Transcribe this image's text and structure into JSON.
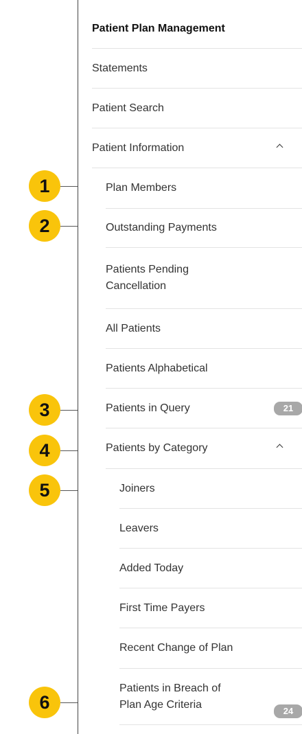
{
  "nav": {
    "title": "Patient Plan Management",
    "statements": "Statements",
    "patient_search": "Patient Search",
    "patient_information": "Patient Information",
    "plan_members": "Plan Members",
    "outstanding_payments": "Outstanding Payments",
    "patients_pending_cancellation": [
      "Patients Pending",
      "Cancellation"
    ],
    "all_patients": "All Patients",
    "patients_alphabetical": "Patients Alphabetical",
    "patients_in_query": {
      "label": "Patients in Query",
      "count": "21"
    },
    "patients_by_category": "Patients by Category",
    "joiners": "Joiners",
    "leavers": "Leavers",
    "added_today": "Added Today",
    "first_time_payers": "First Time Payers",
    "recent_change_of_plan": "Recent Change of Plan",
    "patients_breach": {
      "label": [
        "Patients in Breach of",
        "Plan Age Criteria"
      ],
      "count": "24"
    }
  },
  "callouts": [
    "1",
    "2",
    "3",
    "4",
    "5",
    "6"
  ],
  "colors": {
    "callout": "#f9c40b",
    "badge": "#a8a8a8"
  }
}
